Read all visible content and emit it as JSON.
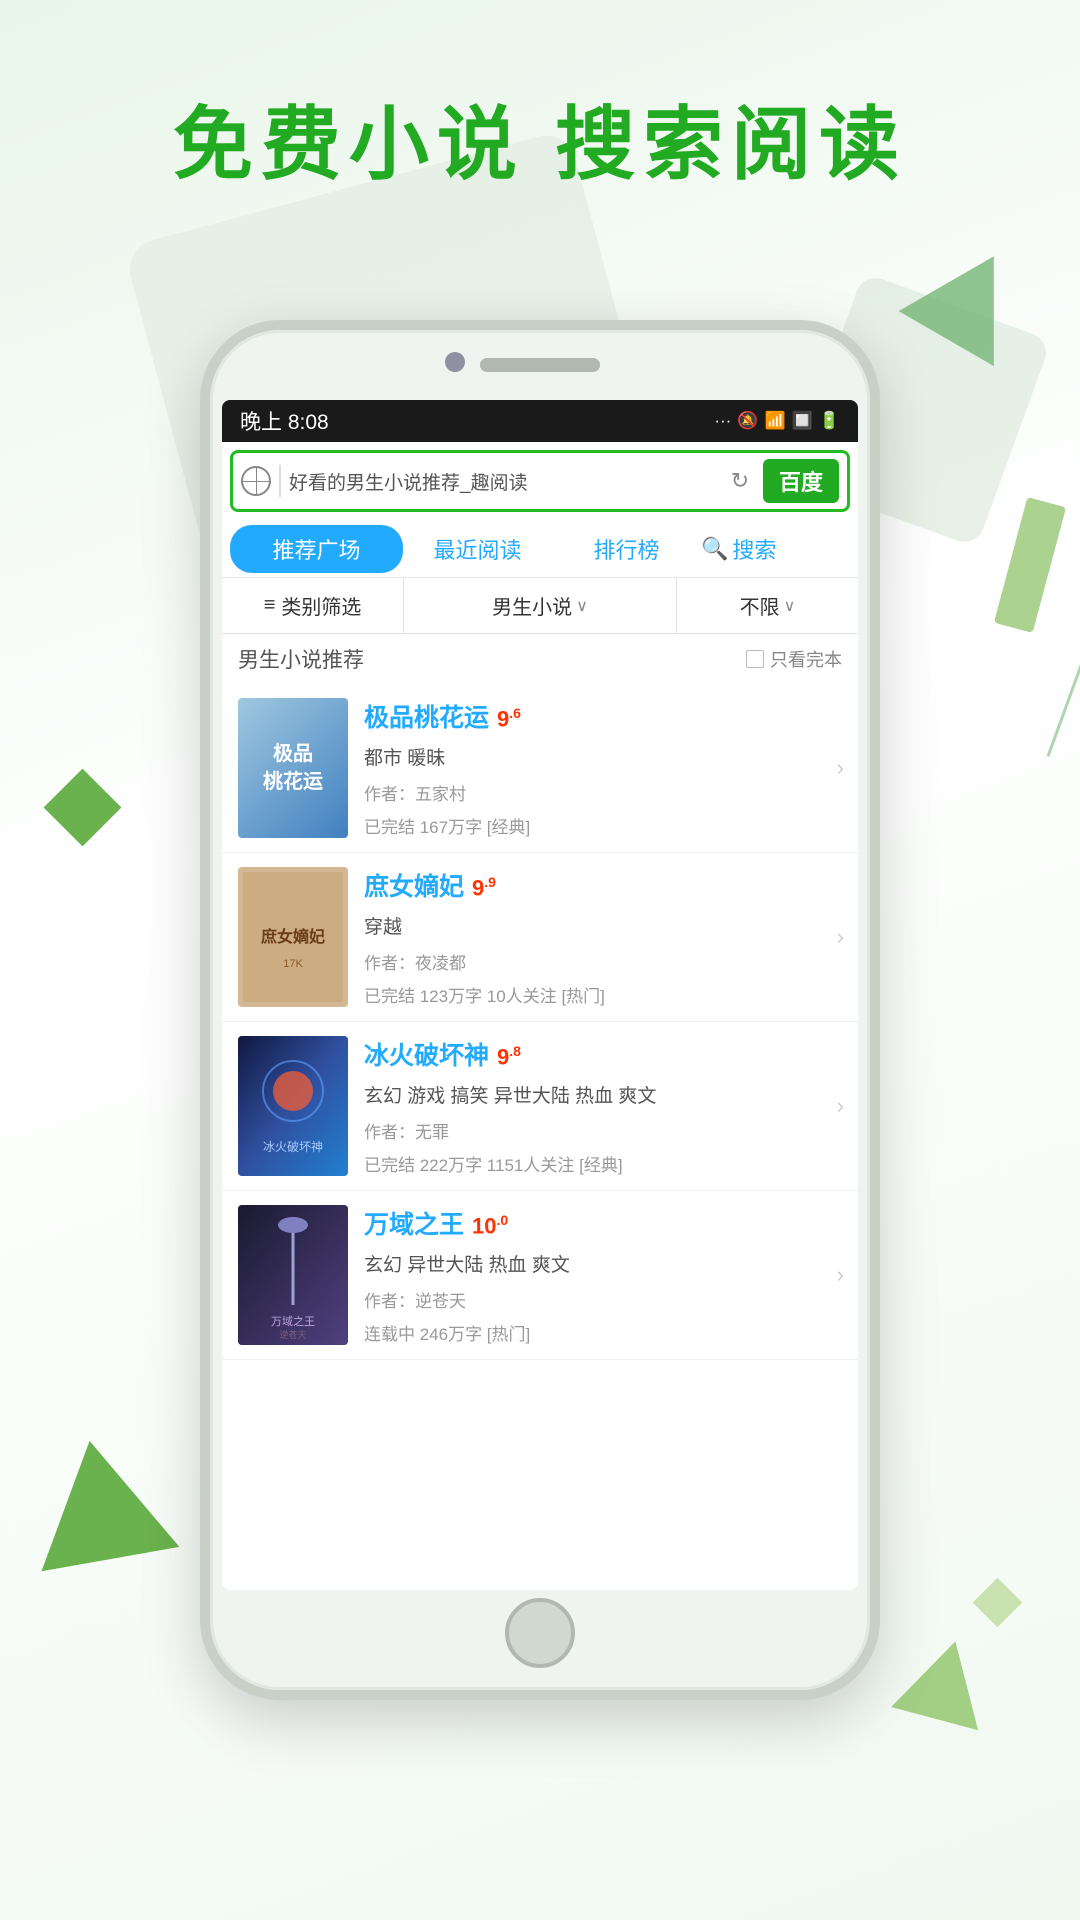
{
  "hero": {
    "title": "免费小说  搜索阅读"
  },
  "status_bar": {
    "time": "晚上 8:08",
    "signal": "···",
    "mute_icon": "🔕",
    "wifi_icon": "📶",
    "sim_icon": "🔲",
    "battery_icon": "🔋"
  },
  "browser": {
    "url": "好看的男生小说推荐_趣阅读",
    "baidu_label": "百度"
  },
  "tabs": [
    {
      "id": "recommend",
      "label": "推荐广场",
      "active": true
    },
    {
      "id": "recent",
      "label": "最近阅读",
      "active": false
    },
    {
      "id": "ranking",
      "label": "排行榜",
      "active": false
    },
    {
      "id": "search",
      "label": "搜索",
      "active": false
    }
  ],
  "filter": {
    "category_label": "类别筛选",
    "gender_label": "男生小说",
    "limit_label": "不限",
    "chevron": "∨"
  },
  "section": {
    "title": "男生小说推荐",
    "only_complete": "只看完本"
  },
  "books": [
    {
      "id": 1,
      "title": "极品桃花运",
      "rating": "9",
      "rating_sup": "6",
      "tags": "都市 暖昧",
      "author": "作者：五家村",
      "meta": "已完结 167万字  [经典]",
      "cover_color": "cover-1",
      "cover_text": "极品\n桃花运"
    },
    {
      "id": 2,
      "title": "庶女嫡妃",
      "rating": "9",
      "rating_sup": "9",
      "tags": "穿越",
      "author": "作者：夜凌都",
      "meta": "已完结 123万字 10人关注  [热门]",
      "cover_color": "cover-2",
      "cover_text": "庶女嫡妃"
    },
    {
      "id": 3,
      "title": "冰火破坏神",
      "rating": "9",
      "rating_sup": "8",
      "tags": "玄幻 游戏 搞笑 异世大陆 热血 爽文",
      "author": "作者：无罪",
      "meta": "已完结 222万字 1151人关注  [经典]",
      "cover_color": "cover-3",
      "cover_text": "冰火破坏神"
    },
    {
      "id": 4,
      "title": "万域之王",
      "rating": "10",
      "rating_sup": "0",
      "tags": "玄幻 异世大陆 热血 爽文",
      "author": "作者：逆苍天",
      "meta": "连载中 246万字  [热门]",
      "cover_color": "cover-4",
      "cover_text": "万域之王"
    }
  ],
  "icons": {
    "list_icon": "≡",
    "search_icon": "🔍",
    "globe_icon": "🌐",
    "refresh_icon": "↻",
    "chevron_right": "›"
  }
}
